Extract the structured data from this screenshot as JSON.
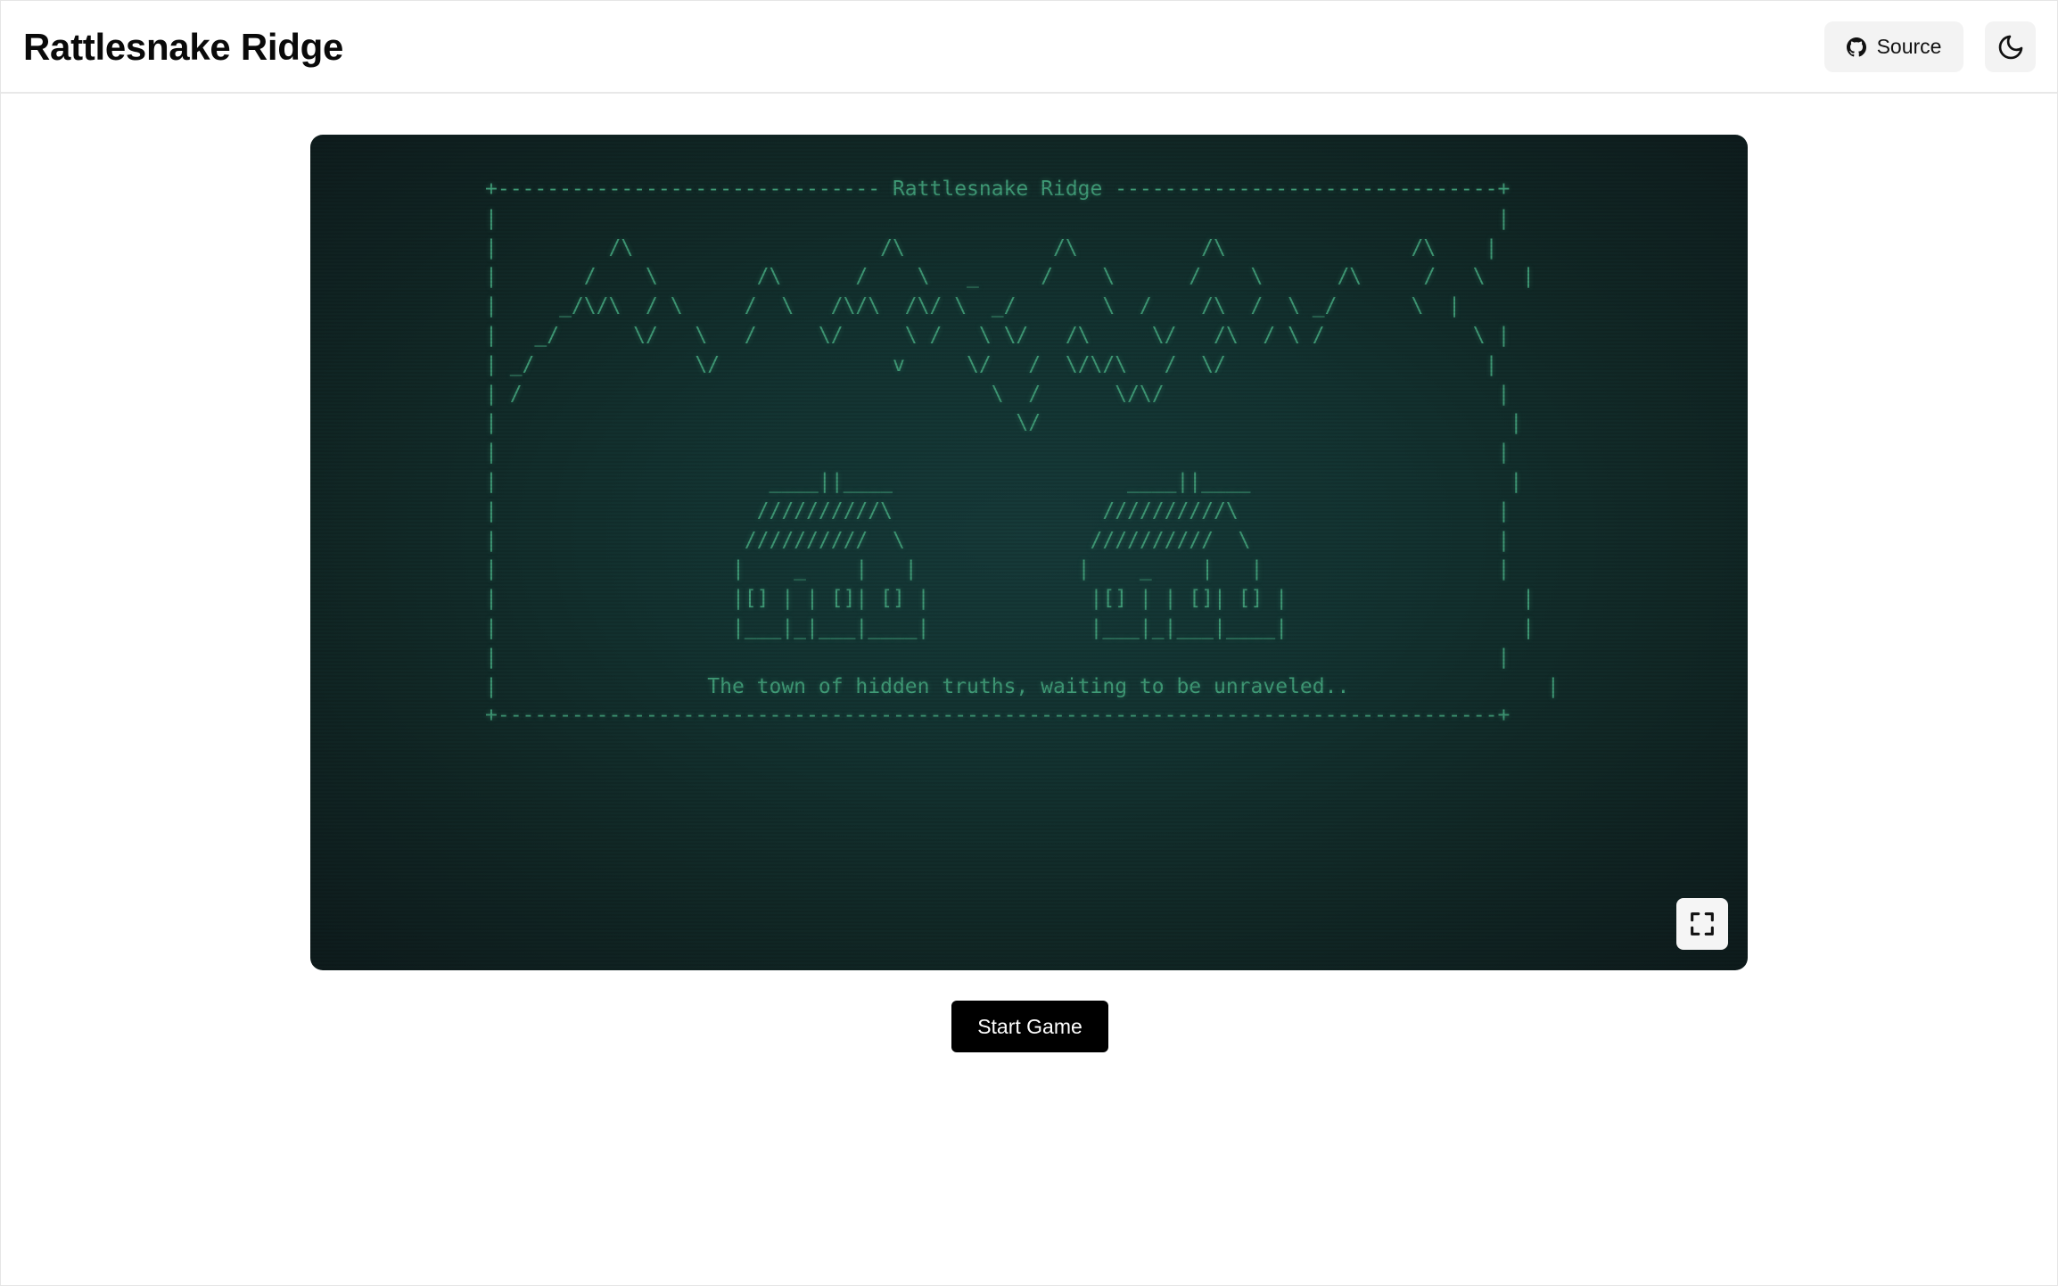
{
  "header": {
    "title": "Rattlesnake Ridge",
    "source_label": "Source",
    "source_icon": "github-icon",
    "theme_icon": "moon-icon"
  },
  "game": {
    "ascii_art": "+------------------------------- Rattlesnake Ridge -------------------------------+\n|                                                                                 |\n|         /\\                    /\\            /\\          /\\               /\\    |\n|       /    \\        /\\      /    \\   _     /    \\      /    \\      /\\     /   \\   |\n|     _/\\/\\  / \\     /  \\   /\\/\\  /\\/ \\  _/       \\  /    /\\  /  \\ _/      \\  |\n|   _/      \\/   \\   /     \\/     \\ /   \\ \\/   /\\     \\/   /\\  / \\ /            \\ |\n| _/             \\/              v     \\/   /  \\/\\/\\   /  \\/                     |\n| /                                      \\  /      \\/\\/                           |\n|                                          \\/                                      |\n|                                                                                 |\n|                      ____||____                   ____||____                     |\n|                     //////////\\                 //////////\\                     |\n|                    //////////  \\               //////////  \\                    |\n|                   |    _    |   |             |    _    |   |                   |\n|                   |[] | | []| [] |             |[] | | []| [] |                   |\n|                   |___|_|___|____|             |___|_|___|____|                   |\n|                                                                                 |\n|                 The town of hidden truths, waiting to be unraveled..                |\n+---------------------------------------------------------------------------------+",
    "fullscreen_icon": "fullscreen-icon",
    "screen_color": "#133331",
    "text_color": "#3f9a76"
  },
  "actions": {
    "start_label": "Start Game"
  }
}
